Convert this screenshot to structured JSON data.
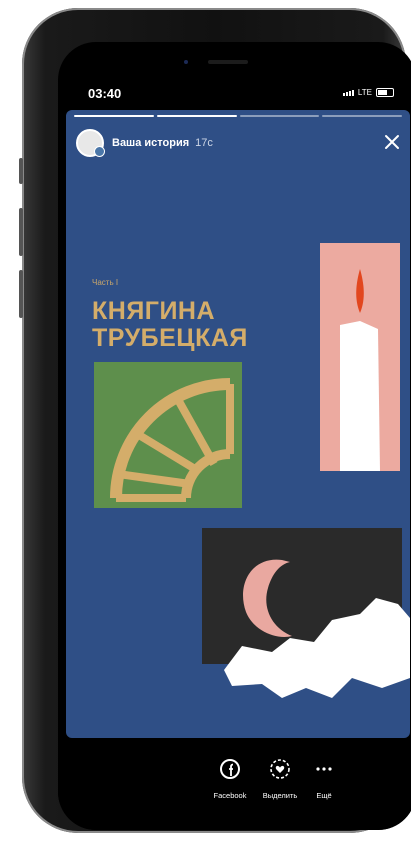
{
  "status_bar": {
    "time": "03:40",
    "network": "LTE"
  },
  "story": {
    "progress": {
      "segments": 4,
      "completed": 2
    },
    "author": "Ваша история",
    "age": "17с",
    "part_label": "Часть I",
    "title_line1": "КНЯГИНА",
    "title_line2": "ТРУБЕЦКАЯ"
  },
  "actions": [
    {
      "label": "Facebook",
      "icon": "facebook-icon"
    },
    {
      "label": "Выделить",
      "icon": "heart-highlight-icon"
    },
    {
      "label": "Ещё",
      "icon": "more-dots-icon"
    }
  ],
  "colors": {
    "story_bg": "#2f4f86",
    "gold": "#d4ad6a",
    "green_panel": "#5e8f4c",
    "pink_panel": "#ecaaa0",
    "flame": "#e2461e",
    "night_panel": "#2a2a2a",
    "moon": "#e9a8a0"
  }
}
